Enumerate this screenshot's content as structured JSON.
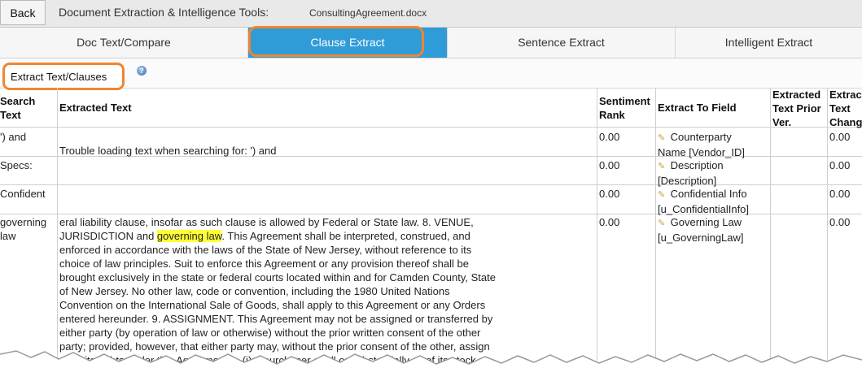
{
  "topbar": {
    "back_label": "Back",
    "app_title": "Document Extraction & Intelligence Tools:",
    "document_name": "ConsultingAgreement.docx"
  },
  "tabs": [
    {
      "label": "Doc Text/Compare",
      "active": false
    },
    {
      "label": "Clause Extract",
      "active": true
    },
    {
      "label": "Sentence Extract",
      "active": false
    },
    {
      "label": "Intelligent Extract",
      "active": false
    }
  ],
  "subtab": {
    "label": "Extract Text/Clauses",
    "help_icon": "help-icon"
  },
  "colors": {
    "active_tab": "#2f9bd7",
    "annotation": "#ef8531",
    "highlight": "#ffff33"
  },
  "table": {
    "headers": {
      "search_text": [
        "Search",
        "Text"
      ],
      "extracted_text": "Extracted Text",
      "sentiment_rank": [
        "Sentiment",
        "Rank"
      ],
      "extract_to_field": "Extract To Field",
      "prior_ver": [
        "Extracted",
        "Text Prior",
        "Ver."
      ],
      "text_change": [
        "Extrac",
        "Text",
        "Chang"
      ]
    },
    "rows": [
      {
        "search": "') and",
        "extracted": "Trouble loading text when searching for: ') and",
        "rank": "0.00",
        "field": [
          "Counterparty",
          "Name [Vendor_ID]"
        ],
        "change": "0.00"
      },
      {
        "search": "Specs:",
        "extracted": "",
        "rank": "0.00",
        "field": [
          "Description",
          "[Description]"
        ],
        "change": "0.00"
      },
      {
        "search": "Confident",
        "extracted": "",
        "rank": "0.00",
        "field": [
          "Confidential Info",
          "[u_ConfidentialInfo]"
        ],
        "change": "0.00"
      },
      {
        "search": [
          "governing",
          "law"
        ],
        "extracted_lines": [
          "eral liability clause, insofar as such clause is allowed by Federal or State law. 8. VENUE,",
          "JURISDICTION and ",
          "governing law",
          ". This Agreement shall be interpreted, construed, and",
          "enforced in accordance with the laws of the State of New Jersey, without reference to its",
          "choice of law principles. Suit to enforce this Agreement or any provision thereof shall be",
          "brought exclusively in the state or federal courts located within and for Camden County, State",
          "of New Jersey. No other law, code or convention, including the 1980 United Nations",
          "Convention on the International Sale of Goods, shall apply to this Agreement or any Orders",
          "entered hereunder. 9. ASSIGNMENT. This Agreement may not be assigned or transferred by",
          "either party (by operation of law or otherwise) without the prior written consent of the other",
          "party; provided, however, that either party may, without the prior consent of the other, assign",
          "all of its rights under this Agreement to (i) a purchaser of all or substantially all of its stock"
        ],
        "rank": "0.00",
        "field": [
          "Governing Law",
          "[u_GoverningLaw]"
        ],
        "change": "0.00"
      }
    ]
  }
}
